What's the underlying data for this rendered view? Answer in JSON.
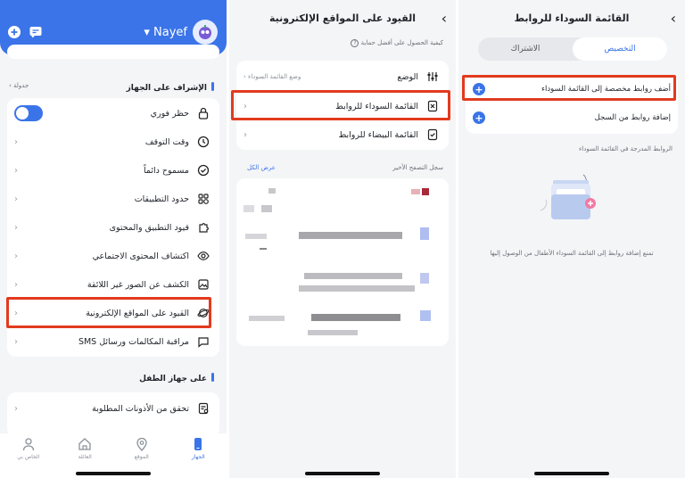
{
  "panel1": {
    "user_name": "Nayef",
    "schedule_link": "جدولة",
    "supervision_title": "الإشراف على الجهاز",
    "items": [
      {
        "label": "حظر فوري",
        "icon": "lock-icon",
        "toggle": true
      },
      {
        "label": "وقت التوقف",
        "icon": "clock-icon"
      },
      {
        "label": "مسموح دائماً",
        "icon": "check-badge-icon"
      },
      {
        "label": "حدود التطبيقات",
        "icon": "app-limit-icon"
      },
      {
        "label": "قيود التطبيق والمحتوى",
        "icon": "puzzle-icon"
      },
      {
        "label": "اكتشاف المحتوى الاجتماعي",
        "icon": "eye-icon"
      },
      {
        "label": "الكشف عن الصور غير اللائقة",
        "icon": "image-scan-icon"
      },
      {
        "label": "القيود على المواقع الإلكترونية",
        "icon": "planet-icon"
      },
      {
        "label": "مراقبة المكالمات ورسائل SMS",
        "icon": "chat-icon"
      }
    ],
    "child_device_title": "على جهاز الطفل",
    "child_items": [
      {
        "label": "تحقق من الأذونات المطلوبة",
        "icon": "checklist-icon"
      }
    ],
    "nav": [
      {
        "label": "الخاص بي",
        "icon": "person-icon"
      },
      {
        "label": "العائلة",
        "icon": "home-icon"
      },
      {
        "label": "الموقع",
        "icon": "location-icon"
      },
      {
        "label": "الجهاز",
        "icon": "device-icon",
        "active": true
      }
    ]
  },
  "panel2": {
    "title": "القيود على المواقع الإلكترونية",
    "help_text": "كيفية الحصول على أفضل حماية",
    "mode_label": "الوضع",
    "mode_value": "وضع القائمة السوداء",
    "blacklist_label": "القائمة السوداء للروابط",
    "whitelist_label": "القائمة البيضاء للروابط",
    "history_label": "سجل التصفح الأخير",
    "show_all": "عرض الكل"
  },
  "panel3": {
    "title": "القائمة السوداء للروابط",
    "tab_custom": "التخصيص",
    "tab_subscription": "الاشتراك",
    "add_custom": "أضف روابط مخصصة إلى القائمة السوداء",
    "add_from_history": "إضافة روابط من السجل",
    "included_label": "الروابط المدرجة في القائمة السوداء",
    "empty_text": "تمنع إضافة روابط إلى القائمة السوداء الأطفال من الوصول إليها"
  },
  "colors": {
    "accent": "#3a74e8",
    "highlight": "#e23a1e"
  }
}
